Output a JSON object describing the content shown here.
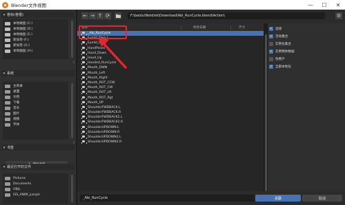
{
  "window": {
    "title": "Blender文件视图",
    "controls": [
      "—",
      "☐",
      "✕"
    ]
  },
  "sidebar": {
    "volumes": {
      "header": "卷标(卷根)",
      "items": [
        {
          "label": "本地磁盘 (C:)"
        },
        {
          "label": "本地磁盘 (D:)"
        },
        {
          "label": "本地磁盘 (E:)"
        },
        {
          "label": "新加卷 (F:)"
        },
        {
          "label": "新加卷 (G:)"
        },
        {
          "label": "本地磁盘 (H:)"
        }
      ]
    },
    "system": {
      "header": "系统",
      "items": [
        {
          "label": "主目录"
        },
        {
          "label": "桌面"
        },
        {
          "label": "文档"
        },
        {
          "label": "下载"
        },
        {
          "label": "音乐"
        },
        {
          "label": "图片"
        },
        {
          "label": "视频"
        },
        {
          "label": "字体"
        }
      ]
    },
    "bookmarks": {
      "header": "书签",
      "add_label": "添加书签"
    },
    "recent": {
      "header": "最近打开的文件",
      "items": [
        {
          "label": "Pictures"
        },
        {
          "label": "Documents"
        },
        {
          "label": "OBJs"
        },
        {
          "label": "ISS_ANIM_jusnph"
        }
      ]
    }
  },
  "toolbar": {
    "nav": [
      "←",
      "→",
      "↑",
      "⟳"
    ],
    "new_folder_icon": "folder-icon",
    "path": "F:\\baidu\\Netdisk\\Download\\Abi_RunCycle.blend\\Action\\"
  },
  "columns": {
    "name": "名称",
    "date": "修改日期",
    "size": "尺寸"
  },
  "files": [
    {
      "name": "_Abi_RunCycle",
      "selected": true
    },
    {
      "name": "Eyelid_Dwn.L"
    },
    {
      "name": "Eyelid_Up.L"
    },
    {
      "name": "HandPoses"
    },
    {
      "name": "Hood_Down"
    },
    {
      "name": "Hood_Up"
    },
    {
      "name": "Hooded_RunCycle"
    },
    {
      "name": "Mouth_DWN"
    },
    {
      "name": "Mouth_Left"
    },
    {
      "name": "Mouth_Right"
    },
    {
      "name": "Mouth_ROT_CCW"
    },
    {
      "name": "Mouth_ROT_CW"
    },
    {
      "name": "Mouth_ROT_Lft"
    },
    {
      "name": "Mouth_ROT_Rgt"
    },
    {
      "name": "Mouth_UP"
    },
    {
      "name": "ShoulderFWDBACK.L"
    },
    {
      "name": "ShoulderFWDBACK.R"
    },
    {
      "name": "ShoulderFWDBACK2.L"
    },
    {
      "name": "ShoulderFWDBACK2.R"
    },
    {
      "name": "ShoulderUPDOWN.L"
    },
    {
      "name": "ShoulderUPDOWN.R"
    },
    {
      "name": "ShoulderUPDOWN2.L"
    },
    {
      "name": "ShoulderUPDOWN2.R"
    }
  ],
  "options": [
    {
      "label": "选择",
      "checked": true
    },
    {
      "label": "活动集合",
      "checked": true
    },
    {
      "label": "实例化集合",
      "checked": false
    },
    {
      "label": "实例物体数据",
      "checked": true
    },
    {
      "label": "伪用户",
      "checked": false
    },
    {
      "label": "全部本地化",
      "checked": true
    }
  ],
  "bottom": {
    "filename": "_Abi_RunCycle",
    "confirm_label": "关联",
    "cancel_label": "取消"
  },
  "colors": {
    "accent": "#4772b3",
    "annotation": "#e6262e"
  }
}
